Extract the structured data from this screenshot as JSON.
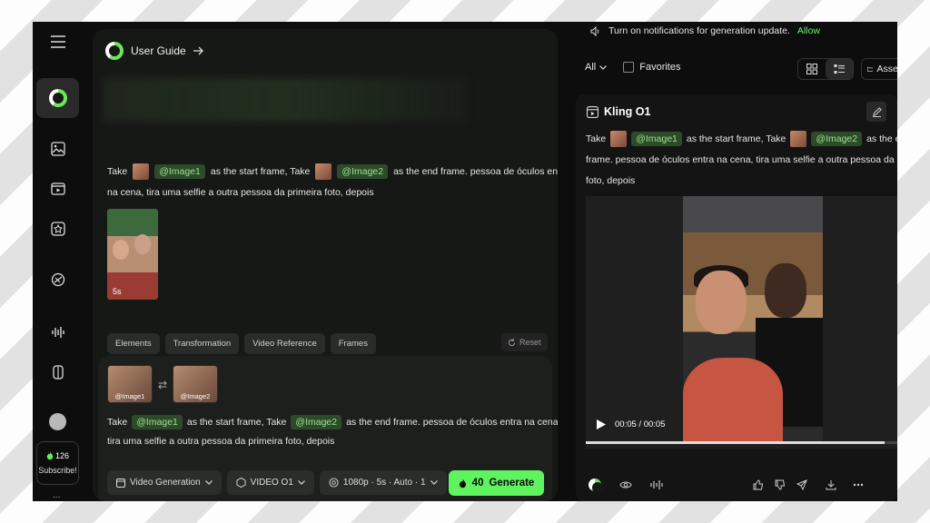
{
  "left": {
    "guide_label": "User Guide",
    "prompt": {
      "take1": "Take",
      "chip1": "@Image1",
      "mid1": "as the start frame, Take",
      "chip2": "@Image2",
      "end1": "as the end frame. pessoa de óculos entra",
      "line2": "na cena, tira uma selfie a outra pessoa da primeira foto, depois"
    },
    "frame_duration": "5s",
    "tabs": [
      "Elements",
      "Transformation",
      "Video Reference",
      "Frames"
    ],
    "reset_label": "Reset"
  },
  "composer": {
    "image1_caption": "@Image1",
    "image2_caption": "@Image2",
    "text": {
      "take": "Take",
      "chip1": "@Image1",
      "mid": "as the start frame, Take",
      "chip2": "@Image2",
      "end": "as the end frame. pessoa de óculos entra na cena,",
      "line2": "tira uma selfie a outra pessoa da primeira foto, depois"
    },
    "mode_label": "Video Generation",
    "model_label": "VIDEO O1",
    "settings_label": "1080p · 5s · Auto · 1",
    "generate": {
      "cost": "40",
      "label": "Generate"
    }
  },
  "sidebar": {
    "credits": "126",
    "subscribe_label": "Subscribe!",
    "more": "..."
  },
  "right": {
    "notification_text": "Turn on notifications for generation update.",
    "notification_action": "Allow",
    "filter_label": "All",
    "favorites_label": "Favorites",
    "assets_label": "Assets",
    "card": {
      "title": "Kling O1",
      "take1": "Take",
      "chip1": "@Image1",
      "mid": "as the start frame, Take",
      "chip2": "@Image2",
      "end": "as the end",
      "line2": "frame. pessoa de óculos entra na cena, tira uma selfie a outra pessoa da primeira",
      "line3": "foto, depois",
      "video_time": "00:05 / 00:05",
      "progress": 0.96
    }
  },
  "colors": {
    "accent": "#5ff35f",
    "chip_bg": "#2d4a2a",
    "chip_text": "#9be58a",
    "panel": "#161816"
  }
}
